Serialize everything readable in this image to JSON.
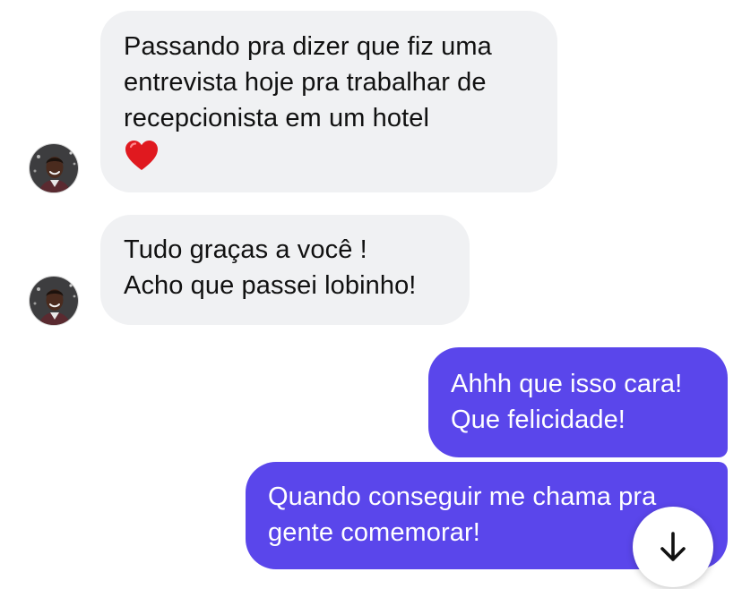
{
  "messages": [
    {
      "direction": "incoming",
      "lines": [
        "Passando pra dizer que fiz uma",
        "entrevista hoje pra trabalhar de",
        "recepcionista em um hotel"
      ],
      "emoji": "heart-icon"
    },
    {
      "direction": "incoming",
      "lines": [
        "Tudo graças a você !",
        "Acho que passei lobinho!"
      ]
    },
    {
      "direction": "outgoing",
      "lines": [
        "Ahhh que isso cara!",
        "Que felicidade!"
      ]
    },
    {
      "direction": "outgoing",
      "lines": [
        "Quando conseguir me chama pra",
        "gente comemorar!"
      ]
    }
  ],
  "scroll_button": {
    "icon": "arrow-down-icon"
  },
  "colors": {
    "incoming_bubble": "#f0f1f3",
    "outgoing_bubble": "#5a46eb",
    "incoming_text": "#111111",
    "outgoing_text": "#ffffff"
  }
}
